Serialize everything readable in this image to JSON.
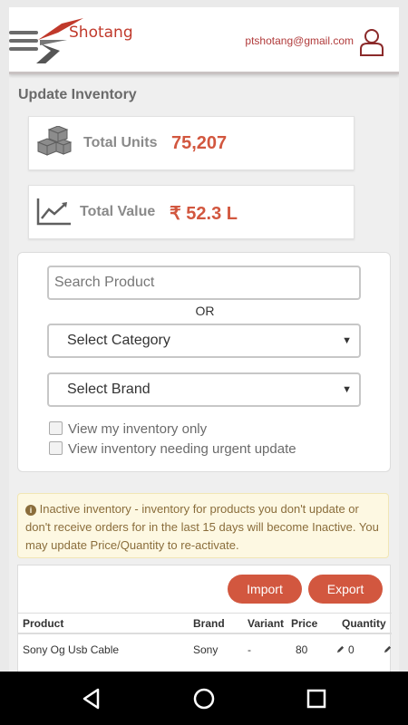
{
  "header": {
    "brand": "Shotang",
    "email": "ptshotang@gmail.com"
  },
  "page_title": "Update Inventory",
  "stats": {
    "units_label": "Total Units",
    "units_value": "75,207",
    "value_label": "Total Value",
    "value_value": "₹ 52.3 L"
  },
  "filters": {
    "search_placeholder": "Search Product",
    "or_label": "OR",
    "category_label": "Select Category",
    "brand_label": "Select Brand",
    "check_my_inventory": "View my inventory only",
    "check_urgent": "View inventory needing urgent update"
  },
  "notice": {
    "text": " Inactive inventory - inventory for products you don't update or don't receive orders for in the last 15 days will become Inactive. You may update Price/Quantity to re-activate."
  },
  "table": {
    "import_label": "Import",
    "export_label": "Export",
    "columns": [
      "Product",
      "Brand",
      "Variant",
      "Price",
      "Quantity"
    ],
    "rows": [
      {
        "product": "Sony Og Usb Cable",
        "brand": "Sony",
        "variant": "-",
        "price": "80",
        "quantity": "0"
      }
    ]
  },
  "colors": {
    "accent": "#d2573f",
    "brand_red": "#c0392b"
  }
}
